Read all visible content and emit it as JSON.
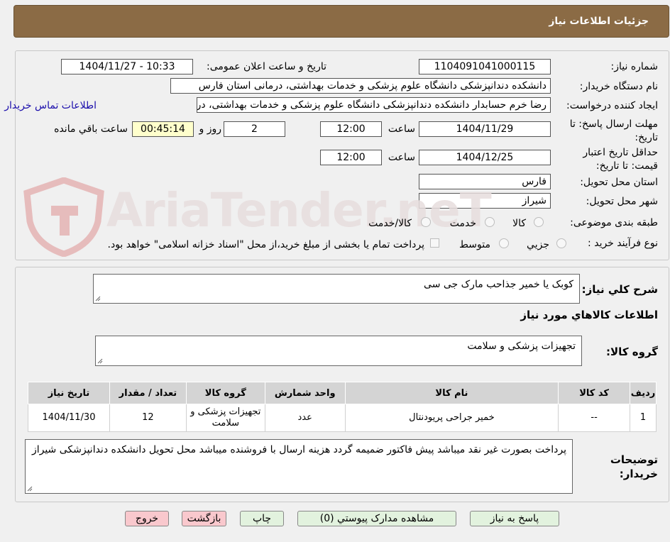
{
  "window": {
    "title": "جزئیات اطلاعات نیاز"
  },
  "header_section": {
    "need_number_label": "شماره نیاز:",
    "need_number": "1104091041000115",
    "announce_label": "تاریخ و ساعت اعلان عمومی:",
    "announce_value": "1404/11/27 - 10:33",
    "buyer_org_label": "نام دستگاه خریدار:",
    "buyer_org": "دانشکده دندانپزشکی دانشگاه علوم پزشکی و خدمات بهداشتی، درمانی استان فارس",
    "requester_label": "ایجاد کننده درخواست:",
    "requester": "رضا خرم حسابدار دانشکده دندانپزشکی دانشگاه علوم پزشکی و خدمات بهداشتی، درمانی استان فارس",
    "contact_link": "اطلاعات تماس خریدار",
    "deadline_label_1": "مهلت ارسال پاسخ: تا",
    "deadline_label_2": "تاریخ:",
    "deadline_date": "1404/11/29",
    "time_label": "ساعت",
    "deadline_time": "12:00",
    "days_value": "2",
    "days_label": "روز و",
    "remaining_time": "00:45:14",
    "remaining_label": "ساعت باقي مانده",
    "validity_label_1": "حداقل تاریخ اعتبار",
    "validity_label_2": "قیمت: تا تاریخ:",
    "validity_date": "1404/12/25",
    "validity_time": "12:00",
    "province_label": "استان محل تحویل:",
    "province": "فارس",
    "city_label": "شهر محل تحویل:",
    "city": "شیراز",
    "category_label": "طبقه بندی موضوعی:",
    "category_options": [
      "کالا",
      "خدمت",
      "کالا/خدمت"
    ],
    "process_label": "نوع فرآیند خرید :",
    "process_options": [
      "جزیي",
      "متوسط"
    ],
    "payment_note": "پرداخت تمام یا بخشی از مبلغ خرید،از محل \"اسناد خزانه اسلامی\" خواهد بود."
  },
  "description": {
    "label": "شرح کلي نياز:",
    "text": "کوبک یا خمیر جذاحب مارک جی سی"
  },
  "goods": {
    "section_title": "اطلاعات کالاهاي مورد نياز",
    "group_label": "گروه کالا:",
    "group_value": "تجهیزات پزشکی و سلامت",
    "columns": [
      "رديف",
      "کد کالا",
      "نام کالا",
      "واحد شمارش",
      "گروه کالا",
      "تعداد / مقدار",
      "تاریخ نیاز"
    ],
    "rows": [
      [
        "1",
        "--",
        "خمیر جراحی پریودنتال",
        "عدد",
        "تجهیزات پزشکی و سلامت",
        "12",
        "1404/11/30"
      ]
    ]
  },
  "buyer_notes": {
    "label_1": "توضیحات",
    "label_2": "خریدار:",
    "text": "پرداخت بصورت غیر نقد میباشد پیش فاکتور ضمیمه گردد هزینه ارسال با فروشنده میباشد محل تحویل دانشکده دندانپزشکی شیراز"
  },
  "buttons": {
    "reply": "پاسخ به نیاز",
    "attachments": "مشاهده مدارک پیوستي (0)",
    "print": "چاپ",
    "back": "بازگشت",
    "exit": "خروج"
  },
  "watermark": {
    "text": "AriaTender.neT"
  },
  "colors": {
    "title_bar": "#8b6b45",
    "remaining_bg": "#ffffcc",
    "green_button": "#e2f2de",
    "red_button": "#f9c8cd",
    "link": "#1a0dab"
  }
}
